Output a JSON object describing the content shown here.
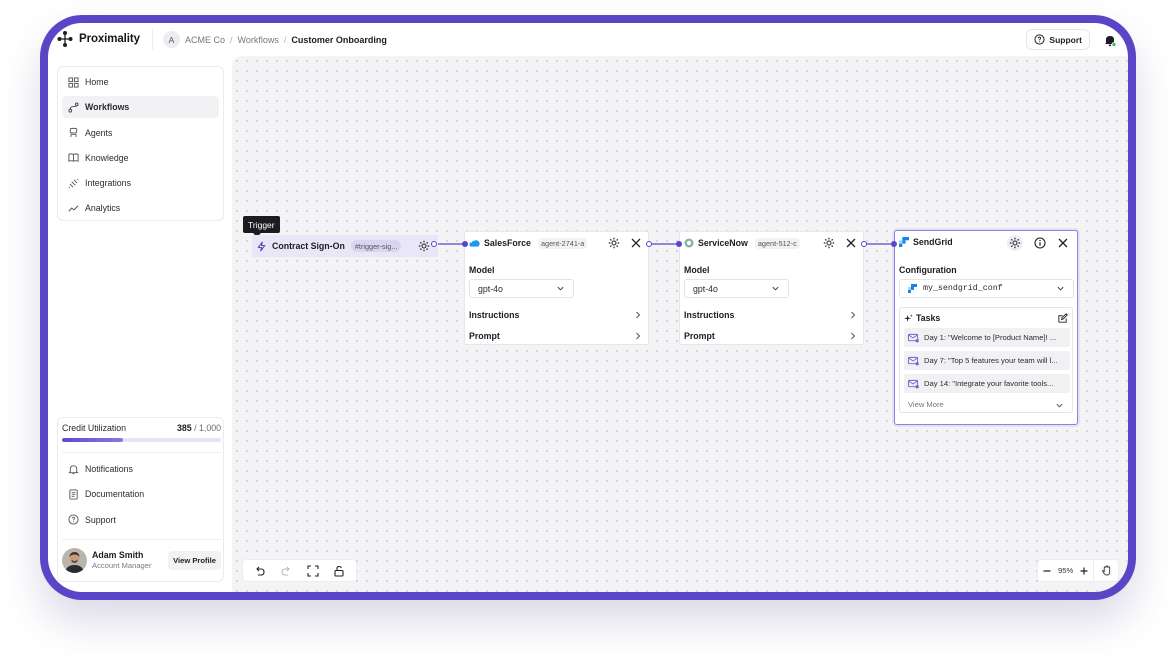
{
  "app": {
    "name": "Proximality"
  },
  "breadcrumb": {
    "org_initial": "A",
    "org": "ACME Co",
    "section": "Workflows",
    "current": "Customer Onboarding"
  },
  "header": {
    "support_label": "Support"
  },
  "sidebar": {
    "items": [
      {
        "label": "Home",
        "icon": "home-grid-icon",
        "active": false
      },
      {
        "label": "Workflows",
        "icon": "workflow-icon",
        "active": true
      },
      {
        "label": "Agents",
        "icon": "agent-icon",
        "active": false
      },
      {
        "label": "Knowledge",
        "icon": "book-icon",
        "active": false
      },
      {
        "label": "Integrations",
        "icon": "plug-icon",
        "active": false
      },
      {
        "label": "Analytics",
        "icon": "analytics-icon",
        "active": false
      }
    ],
    "credit": {
      "label": "Credit Utilization",
      "used": "385",
      "total": "/ 1,000",
      "fraction": 0.385
    },
    "bottom_items": [
      {
        "label": "Notifications",
        "icon": "bell-icon"
      },
      {
        "label": "Documentation",
        "icon": "document-icon"
      },
      {
        "label": "Support",
        "icon": "help-circle-icon"
      }
    ],
    "user": {
      "name": "Adam Smith",
      "role": "Account Manager",
      "profile_button": "View Profile"
    }
  },
  "canvas": {
    "trigger_tooltip": "Trigger",
    "trigger": {
      "name": "Contract Sign-On",
      "tag": "#trigger-sig..."
    },
    "nodes": {
      "salesforce": {
        "title": "SalesForce",
        "agent": "agent-2741-a",
        "model_label": "Model",
        "model": "gpt-4o",
        "instructions": "Instructions",
        "prompt": "Prompt"
      },
      "servicenow": {
        "title": "ServiceNow",
        "agent": "agent-512-c",
        "model_label": "Model",
        "model": "gpt-4o",
        "instructions": "Instructions",
        "prompt": "Prompt"
      },
      "sendgrid": {
        "title": "SendGrid",
        "config_label": "Configuration",
        "config": "my_sendgrid_conf",
        "tasks_label": "Tasks",
        "tasks": [
          "Day 1: \"Welcome to [Product Name]! ...",
          "Day 7: \"Top 5 features your team will l...",
          "Day 14: \"Integrate your favorite tools..."
        ],
        "view_more": "View More"
      }
    }
  },
  "zoom": {
    "level": "95%"
  },
  "colors": {
    "brand": "#5b45c6",
    "accent": "#6048cf",
    "connector": "#5b45c6",
    "trigger_bg": "#e9e7f7"
  }
}
